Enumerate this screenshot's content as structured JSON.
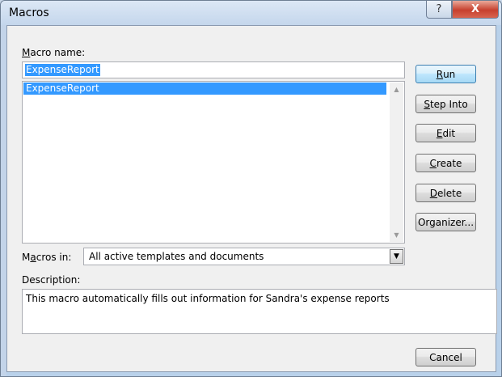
{
  "window": {
    "title": "Macros",
    "help_glyph": "?",
    "close_glyph": "X"
  },
  "macro_name": {
    "label_prefix": "",
    "label_access": "M",
    "label_rest": "acro name:",
    "value": "ExpenseReport"
  },
  "macro_list": {
    "items": [
      "ExpenseReport"
    ],
    "selected_index": 0
  },
  "buttons": {
    "run": {
      "access": "R",
      "rest": "un"
    },
    "step_into": {
      "access": "S",
      "rest": "tep Into"
    },
    "edit": {
      "access": "E",
      "rest": "dit"
    },
    "create": {
      "access": "C",
      "rest": "reate"
    },
    "delete": {
      "access": "D",
      "rest": "elete"
    },
    "organizer": {
      "label": "Organizer..."
    },
    "cancel": {
      "label": "Cancel"
    }
  },
  "macros_in": {
    "label_prefix": "M",
    "label_access": "a",
    "label_rest": "cros in:",
    "value": "All active templates and documents"
  },
  "description": {
    "label": "Description:",
    "text": "This macro automatically fills out information for Sandra's expense reports"
  },
  "icons": {
    "scroll_up": "▲",
    "scroll_down": "▼",
    "dropdown": "▼"
  },
  "colors": {
    "selection": "#3399ff",
    "close_button": "#c7402e",
    "dialog_bg": "#f0f0f0"
  }
}
